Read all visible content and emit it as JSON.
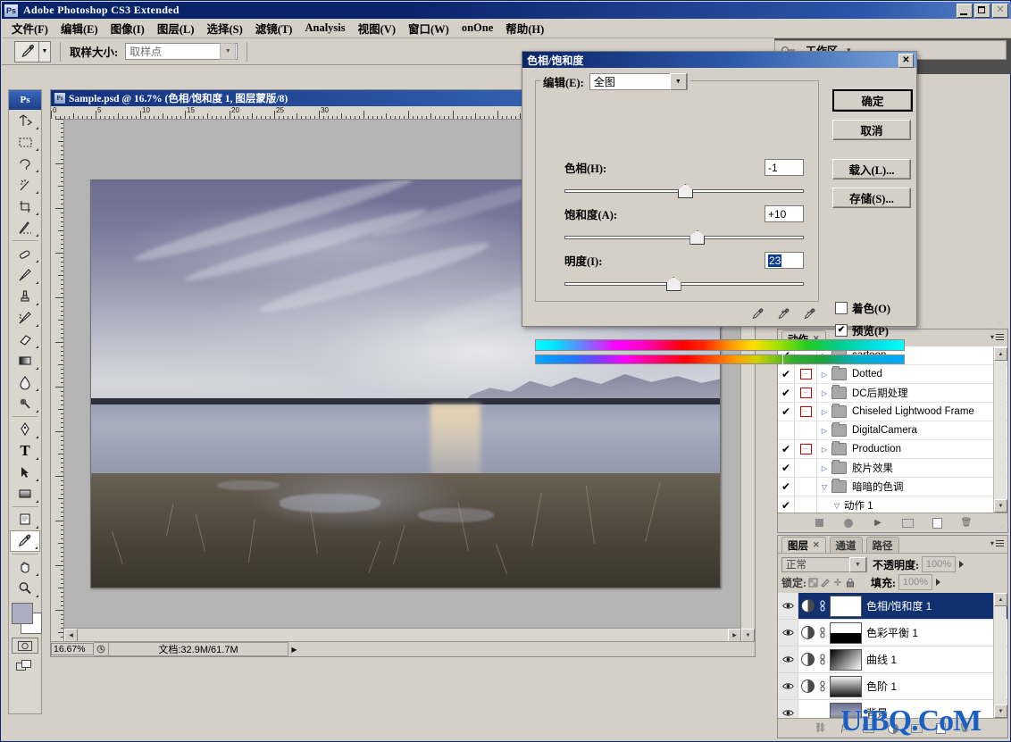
{
  "app": {
    "title": "Adobe Photoshop CS3 Extended",
    "logo": "Ps",
    "window_buttons": {
      "minimize": "minimize-icon",
      "maximize": "maximize-icon",
      "close": "close-icon"
    }
  },
  "menubar": {
    "items": [
      {
        "label": "文件(F)"
      },
      {
        "label": "编辑(E)"
      },
      {
        "label": "图像(I)"
      },
      {
        "label": "图层(L)"
      },
      {
        "label": "选择(S)"
      },
      {
        "label": "滤镜(T)"
      },
      {
        "label": "Analysis"
      },
      {
        "label": "视图(V)"
      },
      {
        "label": "窗口(W)"
      },
      {
        "label": "onOne"
      },
      {
        "label": "帮助(H)"
      }
    ]
  },
  "options_bar": {
    "tool_icon": "eyedropper-icon",
    "sample_size_label": "取样大小:",
    "sample_size_value": "取样点",
    "workspace_label": "工作区"
  },
  "toolbox": {
    "logo": "Ps",
    "tools": [
      {
        "name": "move-tool",
        "glyph": "move-icon"
      },
      {
        "name": "marquee-tool",
        "glyph": "marquee-icon"
      },
      {
        "name": "lasso-tool",
        "glyph": "lasso-icon"
      },
      {
        "name": "magic-wand-tool",
        "glyph": "magic-wand-icon"
      },
      {
        "name": "crop-tool",
        "glyph": "crop-icon"
      },
      {
        "name": "slice-tool",
        "glyph": "slice-icon"
      },
      {
        "name": "healing-brush-tool",
        "glyph": "healing-brush-icon"
      },
      {
        "name": "brush-tool",
        "glyph": "brush-icon"
      },
      {
        "name": "clone-stamp-tool",
        "glyph": "clone-stamp-icon"
      },
      {
        "name": "history-brush-tool",
        "glyph": "history-brush-icon"
      },
      {
        "name": "eraser-tool",
        "glyph": "eraser-icon"
      },
      {
        "name": "gradient-tool",
        "glyph": "gradient-icon"
      },
      {
        "name": "blur-tool",
        "glyph": "blur-icon"
      },
      {
        "name": "dodge-tool",
        "glyph": "dodge-icon"
      },
      {
        "name": "pen-tool",
        "glyph": "pen-icon"
      },
      {
        "name": "type-tool",
        "glyph": "T"
      },
      {
        "name": "path-selection-tool",
        "glyph": "path-arrow-icon"
      },
      {
        "name": "shape-tool",
        "glyph": "rectangle-icon"
      },
      {
        "name": "notes-tool",
        "glyph": "notes-icon"
      },
      {
        "name": "eyedropper-tool",
        "glyph": "eyedropper-icon"
      },
      {
        "name": "hand-tool",
        "glyph": "hand-icon"
      },
      {
        "name": "zoom-tool",
        "glyph": "zoom-icon"
      }
    ],
    "foreground_color": "#aeadc0",
    "background_color": "#ffffff"
  },
  "document": {
    "title": "Sample.psd @ 16.7% (色相/饱和度 1, 图层蒙版/8)",
    "zoom_value": "16.67%",
    "status_text": "文档:32.9M/61.7M",
    "ruler_labels": [
      "0",
      "5",
      "10",
      "15",
      "20",
      "25",
      "30"
    ],
    "ruler_labels_v": [
      "0",
      "5",
      "10",
      "15",
      "20",
      "25"
    ]
  },
  "dialog": {
    "title": "色相/饱和度",
    "close_label": "✕",
    "edit_label": "编辑(E):",
    "edit_value": "全图",
    "sliders": [
      {
        "label": "色相(H):",
        "value": "-1",
        "thumb_pct": 50,
        "highlighted": false
      },
      {
        "label": "饱和度(A):",
        "value": "+10",
        "thumb_pct": 55,
        "highlighted": false
      },
      {
        "label": "明度(I):",
        "value": "23",
        "thumb_pct": 45,
        "highlighted": true
      }
    ],
    "buttons": [
      {
        "label": "确定",
        "default": true
      },
      {
        "label": "取消",
        "default": false
      },
      {
        "label": "载入(L)...",
        "default": false
      },
      {
        "label": "存储(S)...",
        "default": false
      }
    ],
    "checkboxes": [
      {
        "label": "着色(O)",
        "checked": false
      },
      {
        "label": "预览(P)",
        "checked": true
      }
    ],
    "eyedroppers": [
      "eyedropper-icon",
      "eyedropper-plus-icon",
      "eyedropper-minus-icon"
    ]
  },
  "actions_panel": {
    "tab_label": "动作",
    "rows": [
      {
        "label": "cartoon",
        "checked": true,
        "dialog": false,
        "expanded": false,
        "type": "folder"
      },
      {
        "label": "Dotted",
        "checked": true,
        "dialog": true,
        "expanded": false,
        "type": "folder"
      },
      {
        "label": "DC后期处理",
        "checked": true,
        "dialog": true,
        "expanded": false,
        "type": "folder"
      },
      {
        "label": "Chiseled Lightwood Frame",
        "checked": true,
        "dialog": true,
        "expanded": false,
        "type": "folder"
      },
      {
        "label": "DigitalCamera",
        "checked": false,
        "dialog": false,
        "expanded": false,
        "type": "folder"
      },
      {
        "label": "Production",
        "checked": true,
        "dialog": true,
        "expanded": false,
        "type": "folder"
      },
      {
        "label": "胶片效果",
        "checked": true,
        "dialog": false,
        "expanded": false,
        "type": "folder"
      },
      {
        "label": "暗暗的色调",
        "checked": true,
        "dialog": false,
        "expanded": true,
        "type": "folder"
      },
      {
        "label": "动作 1",
        "checked": true,
        "dialog": false,
        "expanded": true,
        "type": "action"
      }
    ],
    "buttons": [
      "stop-button",
      "record-button",
      "play-button",
      "new-set-button",
      "new-action-button",
      "delete-button"
    ]
  },
  "layers_panel": {
    "tabs": [
      {
        "label": "图层",
        "active": true
      },
      {
        "label": "通道",
        "active": false
      },
      {
        "label": "路径",
        "active": false
      }
    ],
    "blend_mode": "正常",
    "opacity_label": "不透明度:",
    "opacity_value": "100%",
    "lock_label": "锁定:",
    "fill_label": "填充:",
    "fill_value": "100%",
    "lock_icons": [
      "lock-transparency-icon",
      "lock-pixels-icon",
      "lock-position-icon",
      "lock-all-icon"
    ],
    "layers": [
      {
        "name": "色相/饱和度 1",
        "selected": true,
        "visible": true,
        "thumb": "#ffffff",
        "type": "adjustment"
      },
      {
        "name": "色彩平衡 1",
        "selected": false,
        "visible": true,
        "thumb": "half-black",
        "type": "adjustment"
      },
      {
        "name": "曲线 1",
        "selected": false,
        "visible": true,
        "thumb": "grad-black",
        "type": "adjustment"
      },
      {
        "name": "色阶 1",
        "selected": false,
        "visible": true,
        "thumb": "grad-gray",
        "type": "adjustment"
      },
      {
        "name": "背景",
        "selected": false,
        "visible": true,
        "thumb": "photo",
        "type": "background"
      }
    ],
    "buttons": [
      "link-layers-icon",
      "fx-icon",
      "mask-icon",
      "adjustment-icon",
      "group-icon",
      "new-layer-icon",
      "delete-layer-icon"
    ]
  },
  "watermark": {
    "text": "UiBQ.CoM",
    "color": "#1b5fc1"
  }
}
